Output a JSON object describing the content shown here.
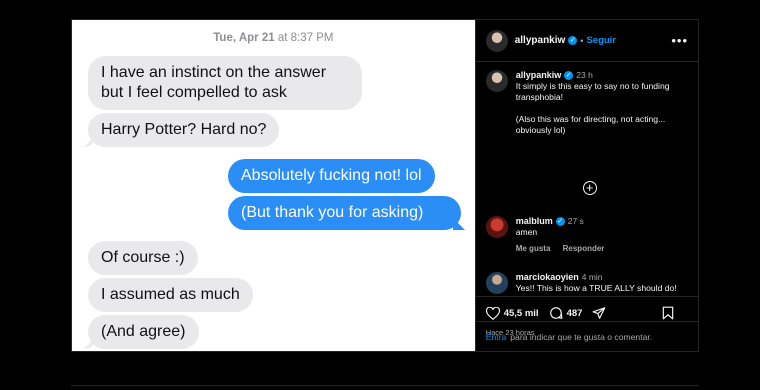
{
  "messages": {
    "timestamp_day": "Tue, Apr 21",
    "timestamp_at": "at",
    "timestamp_time": "8:37 PM",
    "m1_line1": "I have an instinct on the answer",
    "m1_line2": "but I feel compelled to ask",
    "m2": "Harry Potter? Hard no?",
    "m3": "Absolutely fucking not! lol",
    "m4": "(But thank you for asking)",
    "m5": "Of course :)",
    "m6": "I assumed as much",
    "m7": "(And agree)"
  },
  "post": {
    "author": "allypankiw",
    "follow_label": "Seguir",
    "more_icon": "more-horizontal-icon",
    "caption_time": "23 h",
    "caption_text": "It simply is this easy to say no to funding transphobia!\n\n(Also this was for directing, not acting... obviously lol)",
    "comments": [
      {
        "user": "malblum",
        "time": "27 s",
        "text": "amen",
        "like_label": "Me gusta",
        "reply_label": "Responder"
      },
      {
        "user": "marciokaoyien",
        "time": "4 min",
        "text": "Yes!! This is how a TRUE ALLY should do!"
      }
    ],
    "likes_count": "45,5 mil",
    "comments_count": "487",
    "posted_ago": "Hace 23 horas",
    "footer_link": "Entra",
    "footer_text": "para indicar que te gusta o comentar."
  },
  "colors": {
    "sent_bubble": "#2b8ef6",
    "received_bubble": "#e9e9eb",
    "ig_blue": "#0095f6"
  }
}
